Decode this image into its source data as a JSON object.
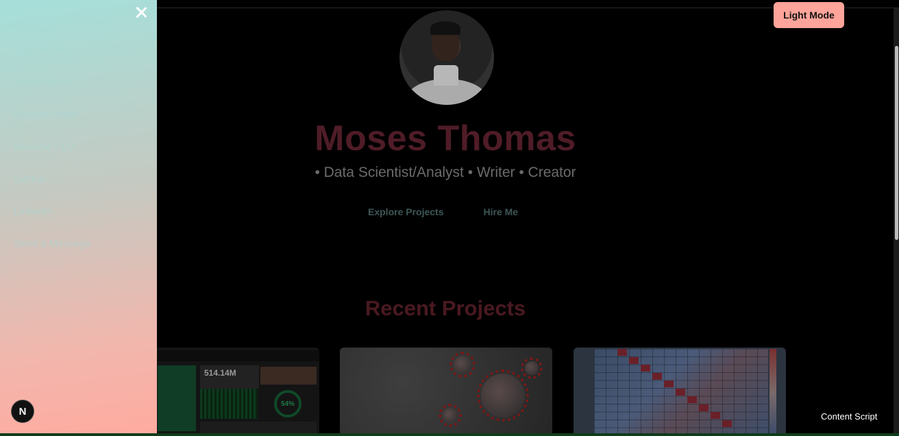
{
  "hero": {
    "name": "Moses Thomas",
    "tagline": "• Data Scientist/Analyst • Writer • Creator",
    "buttons": [
      "Explore Projects",
      "Hire Me"
    ]
  },
  "recent_projects": {
    "title": "Recent Projects",
    "dashboard_kpi": "514.14M",
    "dashboard_gauge": "54%"
  },
  "header": {
    "mode_toggle_label": "Light Mode"
  },
  "sidebar": {
    "items": [
      {
        "label": "View Projects"
      },
      {
        "label": "About Moses"
      },
      {
        "label": "Explore Posts"
      },
      {
        "label": "Resume / CV"
      },
      {
        "label": "GitHub"
      },
      {
        "label": "LinkedIn"
      },
      {
        "label": "Send a Message"
      }
    ],
    "badge_letter": "N"
  },
  "overlay": {
    "content_script_label": "Content Script"
  },
  "colors": {
    "accent_button": "#ffa49a",
    "sidebar_gradient_top": "#a6dfda",
    "sidebar_gradient_bottom": "#ffaba0"
  }
}
